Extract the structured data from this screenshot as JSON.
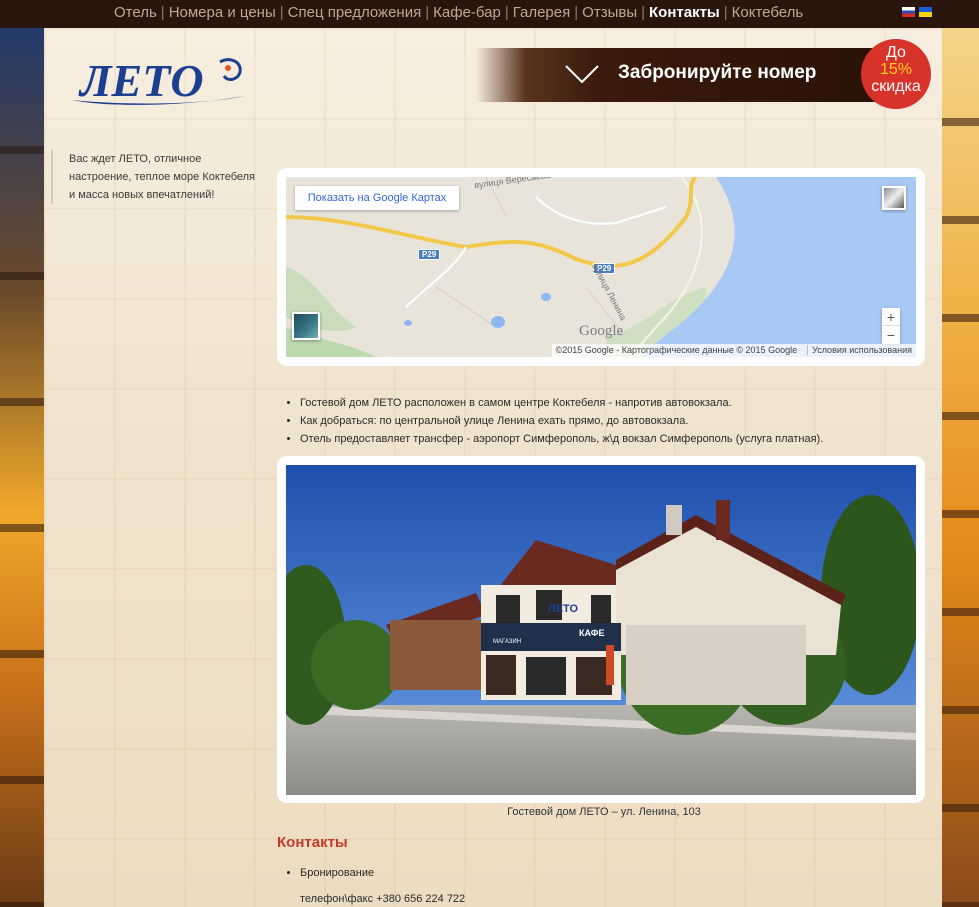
{
  "nav": {
    "items": [
      {
        "label": "Отель",
        "active": false
      },
      {
        "label": "Номера и цены",
        "active": false
      },
      {
        "label": "Спец предложения",
        "active": false
      },
      {
        "label": "Кафе-бар",
        "active": false
      },
      {
        "label": "Галерея",
        "active": false
      },
      {
        "label": "Отзывы",
        "active": false
      },
      {
        "label": "Контакты",
        "active": true
      },
      {
        "label": "Коктебель",
        "active": false
      }
    ],
    "separator": "|",
    "languages": [
      "ru-flag",
      "ua-flag"
    ]
  },
  "logo": {
    "text": "ЛЕТО",
    "color": "#1d3f8f"
  },
  "booking": {
    "label": "Забронируйте номер",
    "discount_line1": "До",
    "discount_pct": "15%",
    "discount_line2": "скидка"
  },
  "intro": {
    "text": "Вас ждет ЛЕТО, отличное настроение, теплое море Коктебеля и масса новых впечатлений!"
  },
  "map": {
    "show_in_google": "Показать на Google Картах",
    "wordmark": "Google",
    "attribution": "©2015 Google - Картографические данные © 2015 Google",
    "terms": "Условия использования",
    "zoom_in": "+",
    "zoom_out": "−",
    "road_shield_1": "P29",
    "road_shield_2": "P29",
    "street_1": "вулиця Вересаєва",
    "street_2": "вулиця Ленина"
  },
  "info": {
    "bullets": [
      "Гостевой дом ЛЕТО расположен в самом центре Коктебеля - напротив автовокзала.",
      "Как добраться: по центральной улице Ленина ехать прямо, до автовокзала.",
      "Отель предоставляет трансфер - аэропорт Симферополь, ж\\д вокзал Симферополь (услуга платная)."
    ]
  },
  "photo": {
    "caption": "Гостевой дом ЛЕТО – ул. Ленина, 103",
    "sign_logo": "ЛЕТО",
    "sign_cafe": "КАФЕ",
    "sign_shop": "МАГАЗИН",
    "sign_rooms": "ГОСТЕВЫЕ НОМЕРА"
  },
  "contacts": {
    "title": "Контакты",
    "items": [
      "Бронирование"
    ],
    "phone": "телефон\\факс  +380 656 224 722"
  },
  "colors": {
    "nav_bg": "#2a150c",
    "accent_red": "#c43a2a",
    "discount_red": "#d8332a",
    "link_blue": "#3367d6"
  }
}
